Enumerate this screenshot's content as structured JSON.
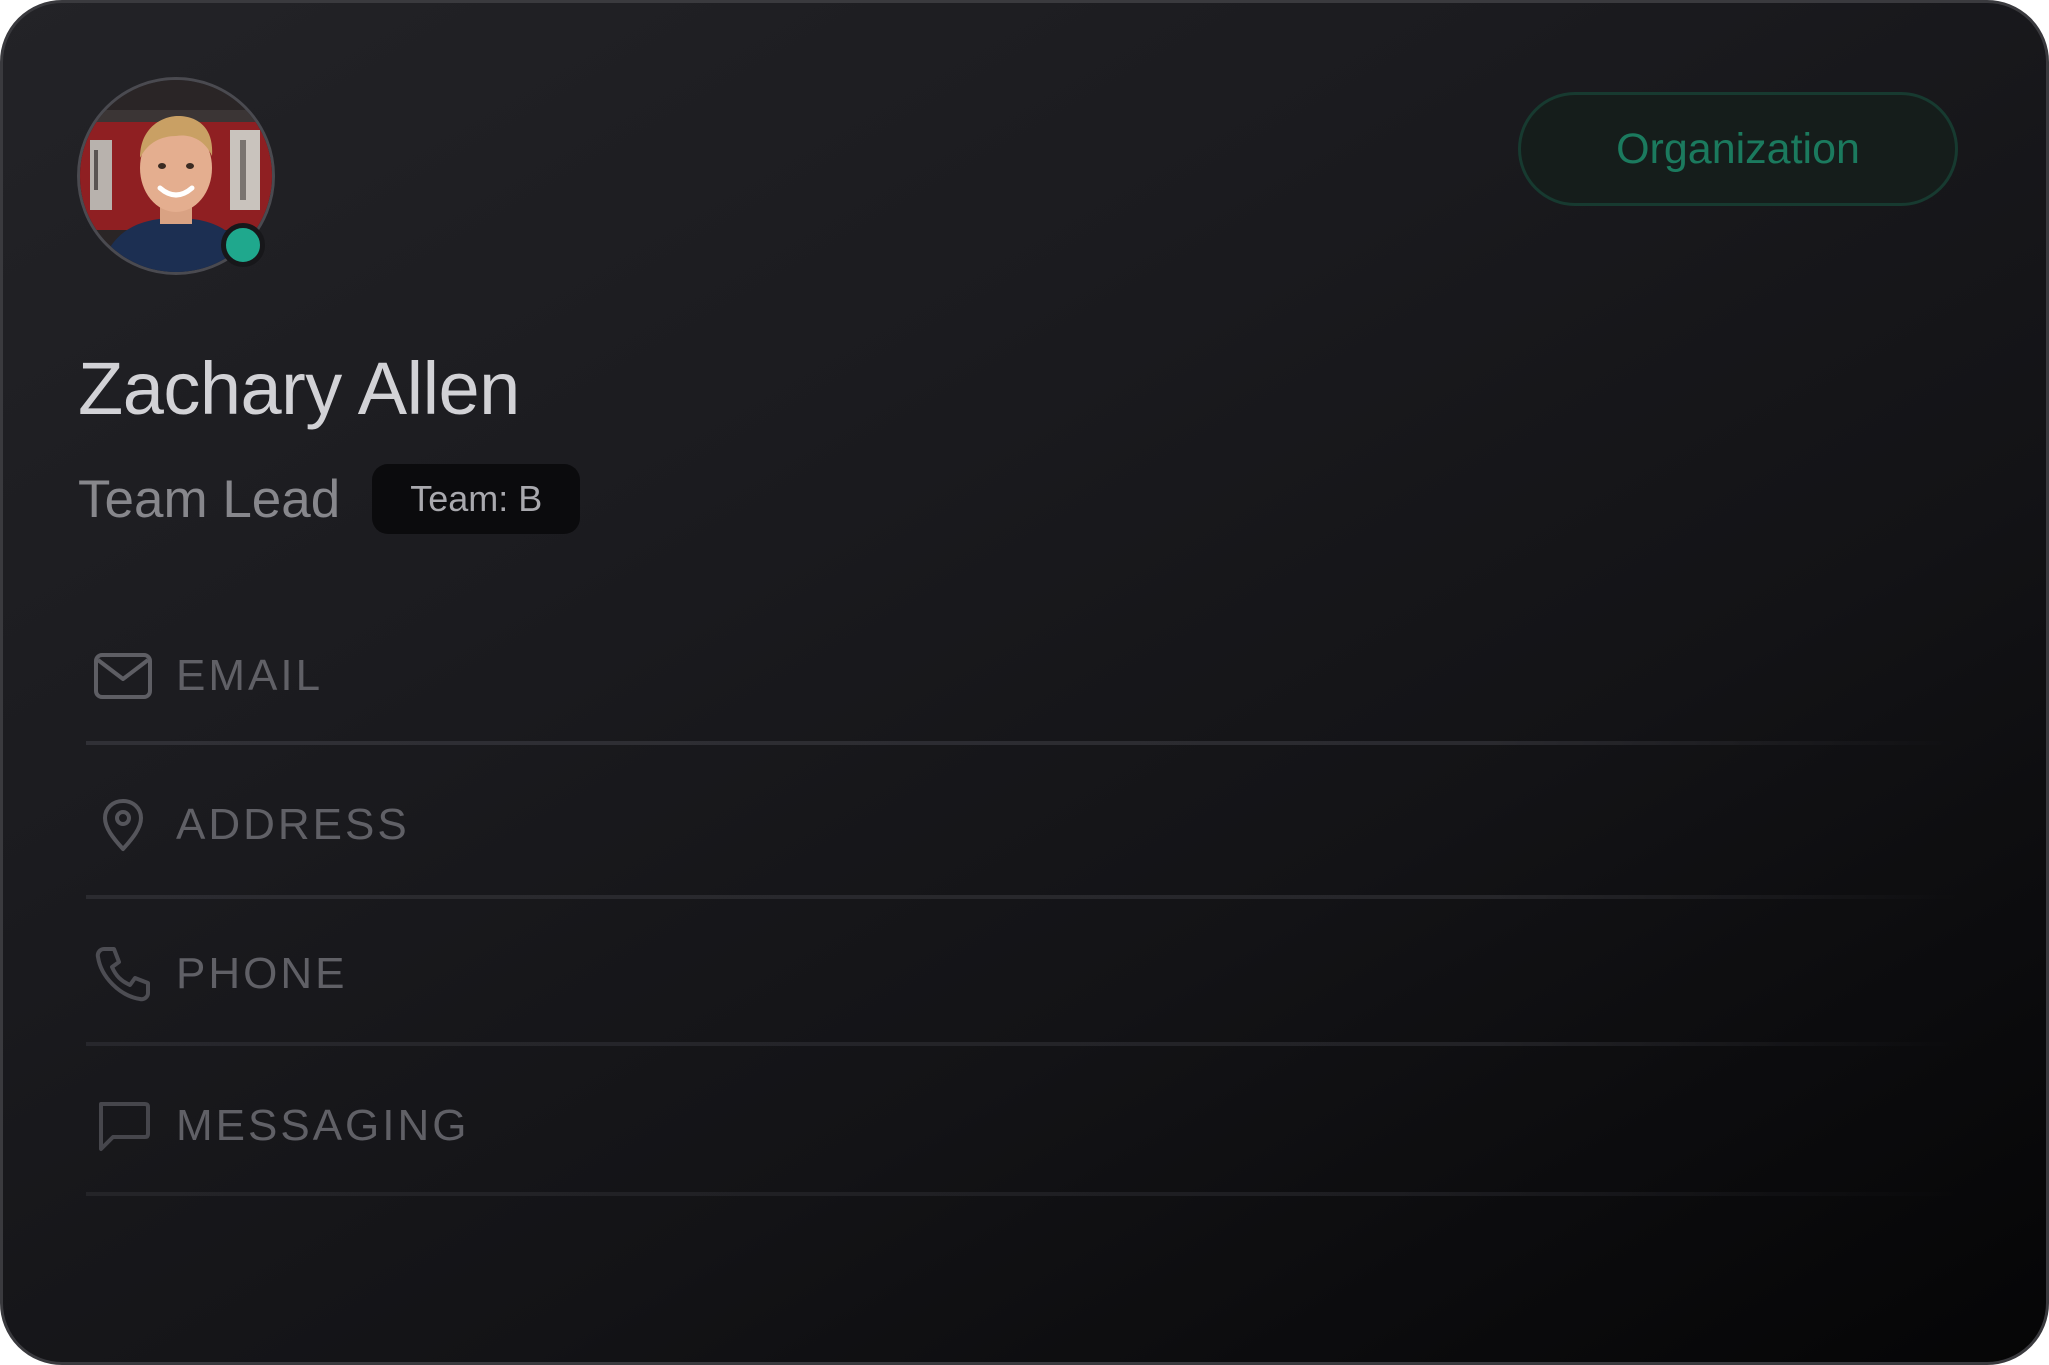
{
  "profile": {
    "name": "Zachary Allen",
    "role": "Team Lead",
    "team_badge": "Team: B",
    "status": "online",
    "avatar_icon": "avatar-photo"
  },
  "header": {
    "organization_label": "Organization"
  },
  "contact_fields": [
    {
      "label": "EMAIL",
      "icon": "mail-icon"
    },
    {
      "label": "ADDRESS",
      "icon": "map-pin-icon"
    },
    {
      "label": "PHONE",
      "icon": "phone-icon"
    },
    {
      "label": "MESSAGING",
      "icon": "message-icon"
    }
  ],
  "colors": {
    "accent": "#1fa88d",
    "organization_text": "#1b7a5e",
    "card_background": "#1b1b1f"
  }
}
